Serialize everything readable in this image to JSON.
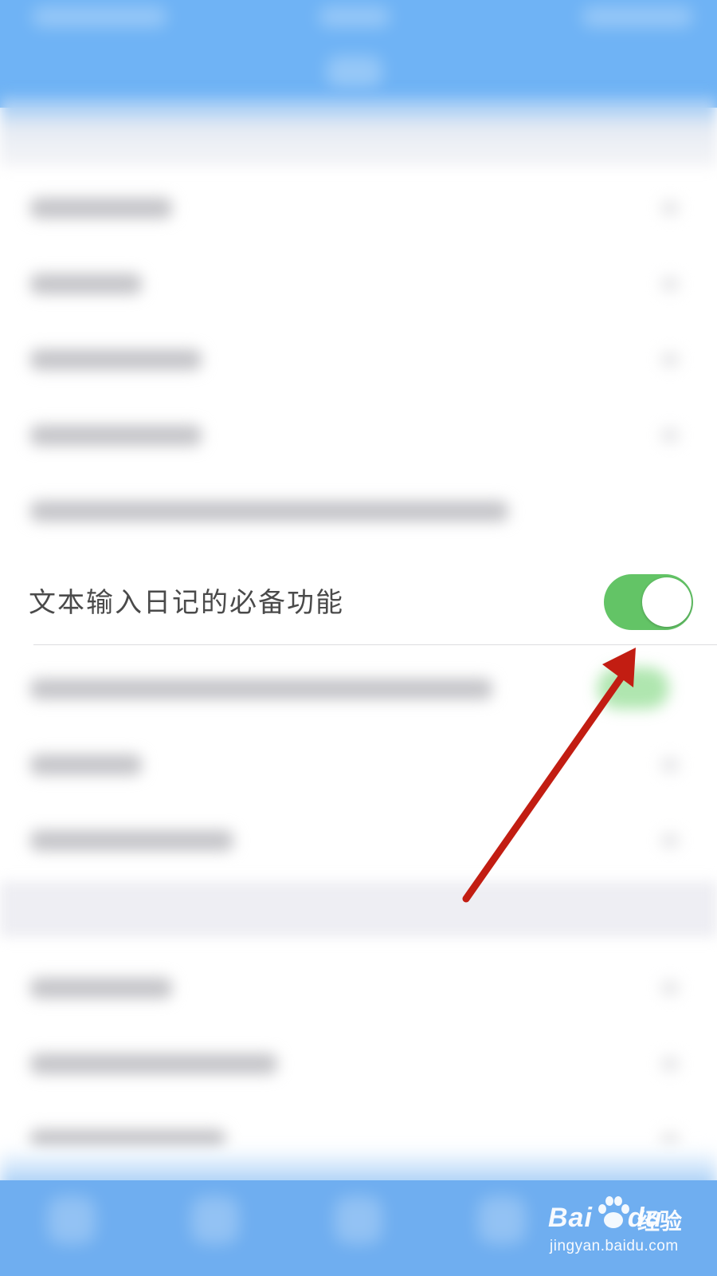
{
  "highlighted_row": {
    "label": "文本输入日记的必备功能",
    "toggle_state": "on",
    "toggle_color": "#63c466"
  },
  "colors": {
    "header_blue": "#6fb3f5",
    "annotation_arrow": "#c21d12"
  },
  "watermark": {
    "logo_text": "Bai",
    "logo_text_suffix": "du",
    "brand_cn": "经验",
    "url": "jingyan.baidu.com"
  }
}
